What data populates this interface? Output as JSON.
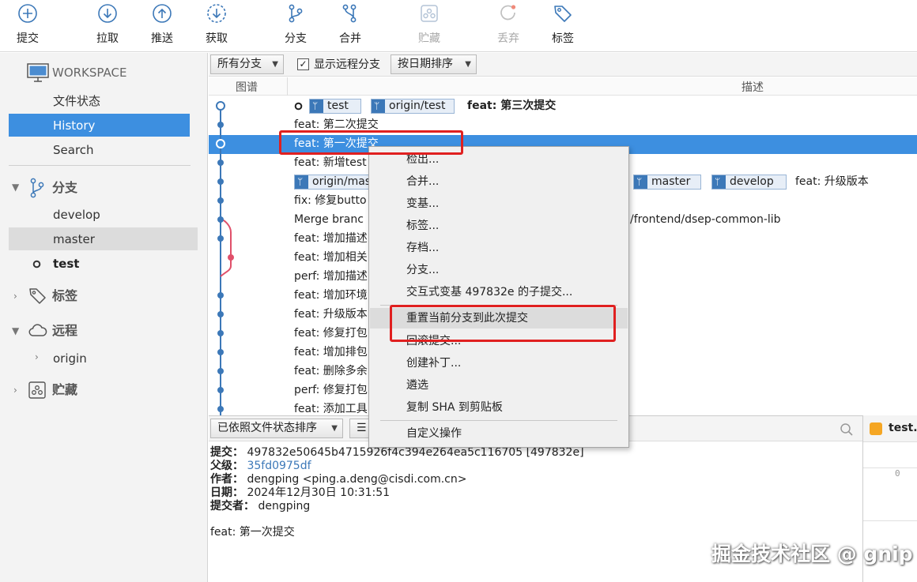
{
  "toolbar": {
    "commit": "提交",
    "pull": "拉取",
    "push": "推送",
    "fetch": "获取",
    "branch": "分支",
    "merge": "合并",
    "stash": "贮藏",
    "discard": "丢弃",
    "tag": "标签"
  },
  "sidebar": {
    "workspace": "WORKSPACE",
    "file_status": "文件状态",
    "history": "History",
    "search": "Search",
    "branches_header": "分支",
    "branches": [
      "develop",
      "master",
      "test"
    ],
    "tags_header": "标签",
    "remotes_header": "远程",
    "remote_origin": "origin",
    "stashes_header": "贮藏"
  },
  "filter": {
    "all_branches": "所有分支",
    "show_remote": "显示远程分支",
    "sort_by_date": "按日期排序"
  },
  "columns": {
    "graph": "图谱",
    "description": "描述"
  },
  "commits": [
    "feat: 第三次提交",
    "feat: 第二次提交",
    "feat: 第一次提交",
    "feat: 新增test",
    "feat: 升级版本",
    "fix: 修复butto",
    "Merge branc",
    "feat: 增加描述",
    "feat: 增加相关",
    "perf: 增加描述",
    "feat: 增加环境",
    "feat: 升级版本",
    "feat: 修复打包",
    "feat: 增加排包",
    "feat: 删除多余",
    "perf: 修复打包",
    "feat: 添加工具"
  ],
  "refs": {
    "test": "test",
    "origin_test": "origin/test",
    "origin_master": "origin/mas",
    "master": "master",
    "develop": "develop",
    "merge_tail": "/frontend/dsep-common-lib"
  },
  "bottom": {
    "sort_label": "已依照文件状态排序",
    "list_icon": "☰",
    "file_tab": "test.js",
    "line_no": "0"
  },
  "details": {
    "commit_label": "提交：",
    "commit_value": "497832e50645b4715926f4c394e264ea5c116705 [497832e]",
    "parent_label": "父级：",
    "parent_value": "35fd0975df",
    "author_label": "作者：",
    "author_value": "dengping <ping.a.deng@cisdi.com.cn>",
    "date_label": "日期：",
    "date_value": "2024年12月30日 10:31:51",
    "committer_label": "提交者：",
    "committer_value": "dengping",
    "message": "feat: 第一次提交"
  },
  "context_menu": [
    "检出...",
    "合并...",
    "变基...",
    "标签...",
    "存档...",
    "分支...",
    "交互式变基 497832e 的子提交...",
    "重置当前分支到此次提交",
    "回滚提交...",
    "创建补丁...",
    "遴选",
    "复制 SHA 到剪贴板",
    "自定义操作"
  ],
  "watermark": "掘金技术社区 @ gnip",
  "colors": {
    "selection": "#3d8fe0",
    "highlight_box": "#e02020",
    "graph_line": "#3c78b8",
    "merge_line": "#e0506a"
  }
}
